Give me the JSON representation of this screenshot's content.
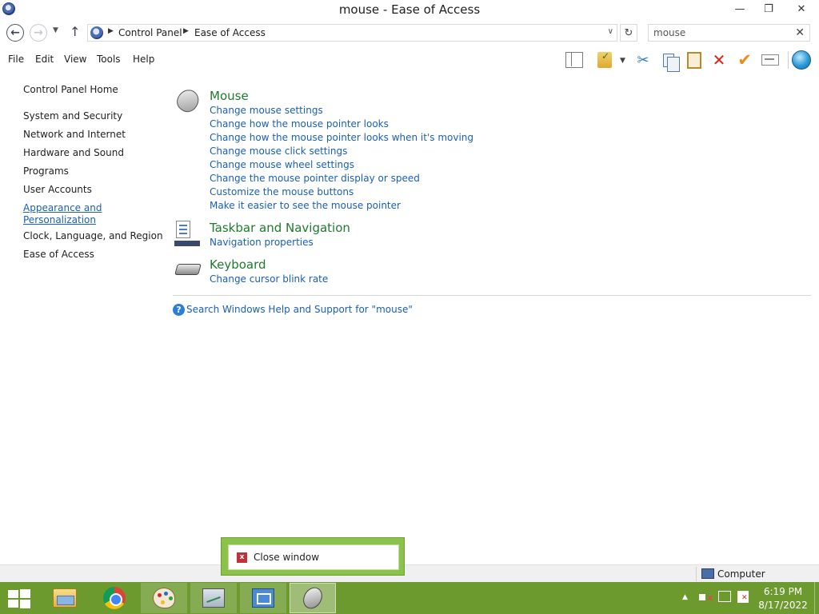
{
  "window": {
    "title": "mouse - Ease of Access",
    "minimize_glyph": "—",
    "maximize_glyph": "❐",
    "close_glyph": "✕"
  },
  "nav": {
    "back_glyph": "←",
    "forward_glyph": "→",
    "recent_glyph": "▼",
    "up_glyph": "↑",
    "breadcrumbs": [
      "Control Panel",
      "Ease of Access"
    ],
    "crumb_separator": "▶",
    "address_dropdown_glyph": "∨",
    "refresh_glyph": "↻"
  },
  "search": {
    "value": "mouse",
    "clear_glyph": "✕"
  },
  "menu": [
    "File",
    "Edit",
    "View",
    "Tools",
    "Help"
  ],
  "toolbar": {
    "icons": [
      "layout-icon",
      "properties-icon",
      "cut-icon",
      "copy-icon",
      "paste-icon",
      "delete-icon",
      "checkmark-icon",
      "rename-icon",
      "globe-icon"
    ],
    "cut_glyph": "✂",
    "delete_glyph": "✕",
    "check_glyph": "✔",
    "dropdown_glyph": "▼"
  },
  "left_nav": {
    "home": "Control Panel Home",
    "items": [
      "System and Security",
      "Network and Internet",
      "Hardware and Sound",
      "Programs",
      "User Accounts",
      "Appearance and",
      "Personalization",
      "Clock, Language, and Region",
      "Ease of Access"
    ]
  },
  "results": {
    "categories": [
      {
        "title": "Mouse",
        "icon": "mouse-icon",
        "tasks": [
          "Change mouse settings",
          "Change how the mouse pointer looks",
          "Change how the mouse pointer looks when it's moving",
          "Change mouse click settings",
          "Change mouse wheel settings",
          "Change the mouse pointer display or speed",
          "Customize the mouse buttons",
          "Make it easier to see the mouse pointer"
        ]
      },
      {
        "title": "Taskbar and Navigation",
        "icon": "taskbar-icon",
        "tasks": [
          "Navigation properties"
        ]
      },
      {
        "title": "Keyboard",
        "icon": "keyboard-icon",
        "tasks": [
          "Change cursor blink rate"
        ]
      }
    ],
    "help_glyph": "?",
    "help_link": "Search Windows Help and Support for \"mouse\""
  },
  "status_bar": {
    "location": "Computer"
  },
  "popup": {
    "close_label": "Close window",
    "close_glyph": "x"
  },
  "taskbar": {
    "apps": [
      "file-explorer-icon",
      "chrome-icon",
      "paint-icon",
      "performance-monitor-icon",
      "remote-desktop-icon",
      "mouse-app-icon"
    ],
    "tray_arrow_glyph": "▲",
    "time": "6:19 PM",
    "date": "8/17/2022",
    "accent": "#6c9a2e"
  },
  "colors": {
    "link": "#1a5fb4",
    "category_title": "#1e7a2e",
    "taskbar": "#6c9a2e",
    "popup_border": "#8bc34a"
  }
}
